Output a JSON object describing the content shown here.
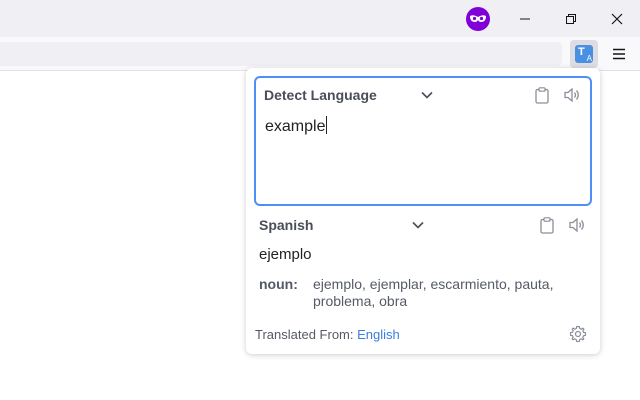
{
  "window": {
    "private_icon": "private-browsing-mask-icon",
    "controls": [
      "minimize-icon",
      "maximize-icon",
      "close-icon"
    ]
  },
  "toolbar": {
    "extension_icon": "translate-icon",
    "menu_icon": "hamburger-menu-icon"
  },
  "translator": {
    "source": {
      "language": "Detect Language",
      "text": "example"
    },
    "target": {
      "language": "Spanish",
      "text": "ejemplo"
    },
    "dictionary": [
      {
        "pos": "noun:",
        "words": "ejemplo, ejemplar, escarmiento, pauta, problema, obra"
      }
    ],
    "footer": {
      "prefix": "Translated From:",
      "language": "English"
    },
    "colors": {
      "accent": "#4f8ff5",
      "link": "#3b7de0",
      "private": "#8000d7"
    }
  }
}
